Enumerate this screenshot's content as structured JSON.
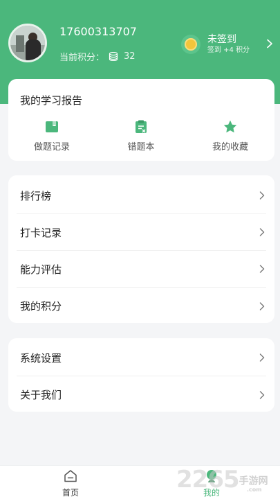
{
  "profile": {
    "phone": "17600313707",
    "points_label": "当前积分：",
    "points_value": "32"
  },
  "checkin": {
    "status": "未签到",
    "reward": "签到 +4 积分"
  },
  "report": {
    "title": "我的学习报告",
    "items": [
      {
        "label": "做题记录",
        "icon": "practice-record-icon"
      },
      {
        "label": "错题本",
        "icon": "wrong-questions-icon"
      },
      {
        "label": "我的收藏",
        "icon": "star-icon"
      }
    ]
  },
  "menu1": [
    {
      "label": "排行榜"
    },
    {
      "label": "打卡记录"
    },
    {
      "label": "能力评估"
    },
    {
      "label": "我的积分"
    }
  ],
  "menu2": [
    {
      "label": "系统设置"
    },
    {
      "label": "关于我们"
    }
  ],
  "tabbar": {
    "home": "首页",
    "mine": "我的"
  },
  "watermark": {
    "brand": "2265",
    "suffix": "手游网",
    "url": ".com"
  },
  "colors": {
    "accent": "#4bb77c",
    "background": "#f4f5f7",
    "coin": "#f3c53a"
  }
}
